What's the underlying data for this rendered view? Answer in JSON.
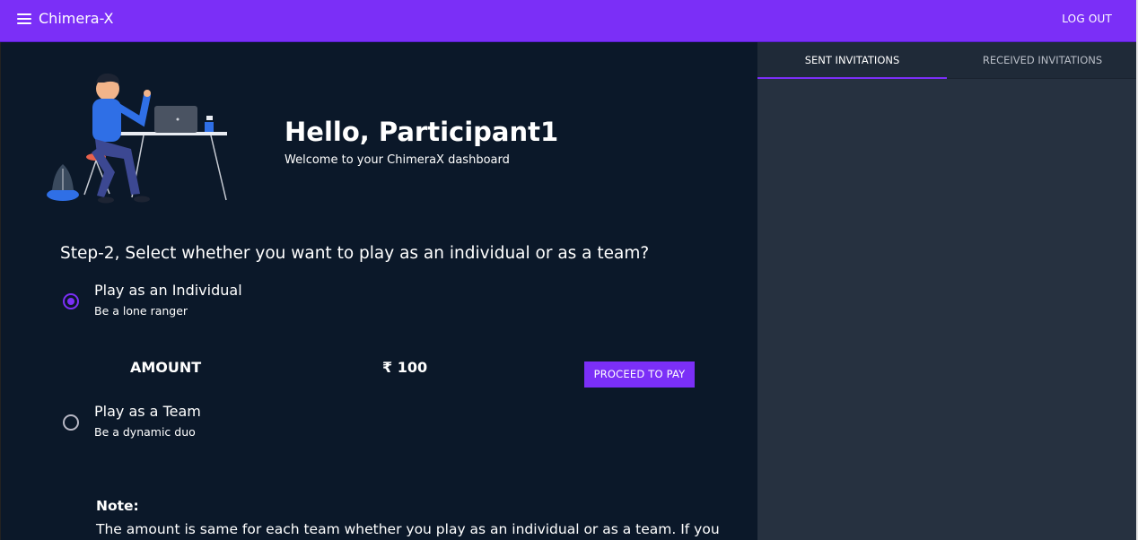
{
  "appbar": {
    "title": "Chimera-X",
    "logout_label": "LOG OUT"
  },
  "greeting": {
    "title": "Hello, Participant1",
    "subtitle": "Welcome to your ChimeraX dashboard"
  },
  "step": {
    "question": "Step-2, Select whether you want to play as an individual or as a team?"
  },
  "options": [
    {
      "title": "Play as an Individual",
      "subtitle": "Be a lone ranger",
      "selected": true
    },
    {
      "title": "Play as a Team",
      "subtitle": "Be a dynamic duo",
      "selected": false
    }
  ],
  "payment": {
    "amount_label": "AMOUNT",
    "amount_value": "₹ 100",
    "button_label": "PROCEED TO PAY"
  },
  "note": {
    "title": "Note:",
    "text": "The amount is same for each team whether you play as an individual or as a team. If you"
  },
  "sidebar": {
    "tabs": [
      {
        "label": "SENT INVITATIONS",
        "active": true
      },
      {
        "label": "RECEIVED INVITATIONS",
        "active": false
      }
    ]
  },
  "colors": {
    "accent": "#7b2ff7",
    "background": "#0b1829",
    "sidebar": "#263140"
  },
  "icons": {
    "menu": "hamburger-menu-icon",
    "illustration": "person-at-desk-illustration"
  }
}
